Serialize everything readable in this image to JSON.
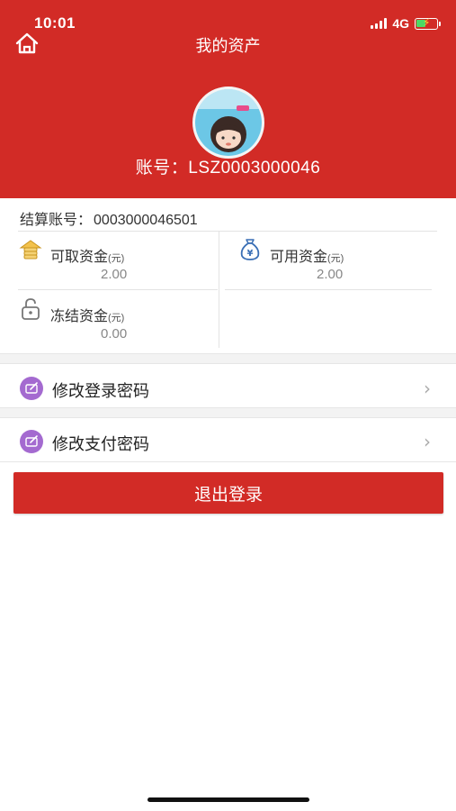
{
  "status_bar": {
    "time": "10:01",
    "network": "4G"
  },
  "header": {
    "title": "我的资产",
    "avatar_icon": "user-avatar",
    "account_prefix": "账号：",
    "account_number": "LSZ0003000046"
  },
  "settlement": {
    "label": "结算账号：",
    "number": "0003000046501"
  },
  "funds": {
    "unit": "(元)",
    "withdrawable": {
      "label": "可取资金",
      "value": "2.00",
      "icon": "coin-stack-icon"
    },
    "available": {
      "label": "可用资金",
      "value": "2.00",
      "icon": "money-bag-icon"
    },
    "frozen": {
      "label": "冻结资金",
      "value": "0.00",
      "icon": "lock-icon"
    }
  },
  "menu": {
    "change_login_password": "修改登录密码",
    "change_pay_password": "修改支付密码"
  },
  "logout_label": "退出登录",
  "colors": {
    "primary": "#d22b26",
    "menu_icon": "#a46ad0"
  }
}
